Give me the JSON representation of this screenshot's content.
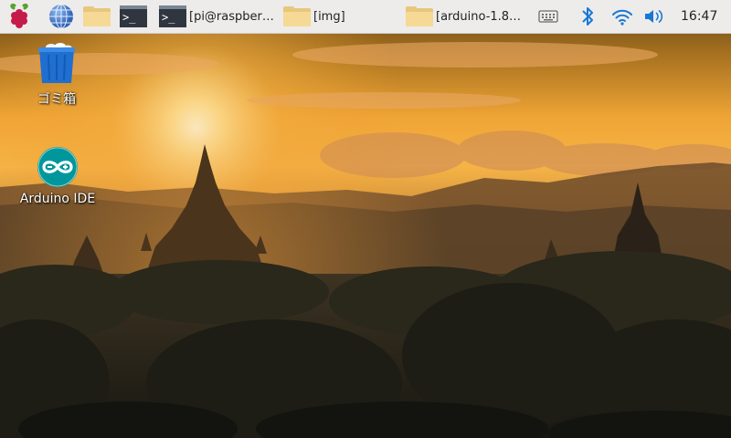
{
  "taskbar": {
    "launchers": [
      {
        "name": "raspberry-menu-icon"
      },
      {
        "name": "web-browser-icon"
      },
      {
        "name": "file-manager-icon"
      },
      {
        "name": "terminal-icon"
      }
    ],
    "tasks": [
      {
        "label": "[pi@raspber…",
        "icon": "terminal-icon",
        "active": false
      },
      {
        "label": "[img]",
        "icon": "folder-icon",
        "active": false
      },
      {
        "label": "[arduino-1.8…",
        "icon": "folder-icon",
        "active": false
      }
    ],
    "tray": {
      "keyboard_icon": "keyboard-icon",
      "bluetooth_icon": "bluetooth-icon",
      "wifi_icon": "wifi-icon",
      "volume_icon": "volume-icon",
      "clock": "16:47"
    }
  },
  "desktop": {
    "icons": [
      {
        "label": "ゴミ箱",
        "icon": "trash-icon"
      },
      {
        "label": "Arduino IDE",
        "icon": "arduino-icon"
      }
    ]
  },
  "colors": {
    "taskbar_bg": "#edeceb",
    "sky_top": "#6a4a1c",
    "sun": "#fff4c8",
    "arduino_teal": "#00979c"
  }
}
